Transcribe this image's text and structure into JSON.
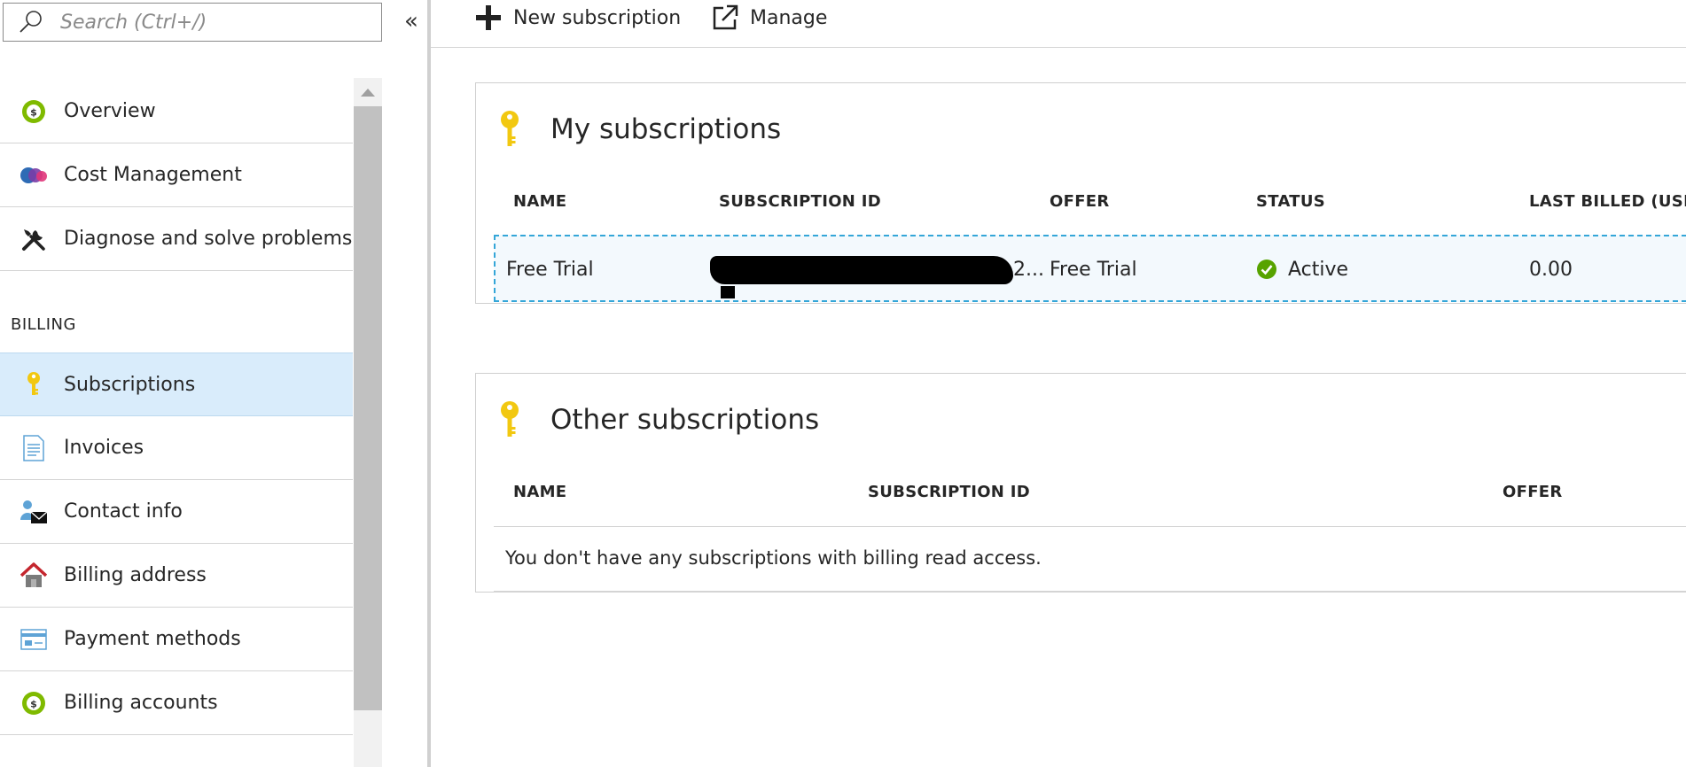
{
  "search": {
    "placeholder": "Search (Ctrl+/)"
  },
  "collapse_label": "«",
  "nav": {
    "items": [
      {
        "label": "Overview",
        "icon": "overview-coin-icon"
      },
      {
        "label": "Cost Management",
        "icon": "cost-management-icon"
      },
      {
        "label": "Diagnose and solve problems",
        "icon": "tools-icon"
      }
    ],
    "billing_section": "BILLING",
    "billing_items": [
      {
        "label": "Subscriptions",
        "icon": "key-icon",
        "selected": true
      },
      {
        "label": "Invoices",
        "icon": "document-icon"
      },
      {
        "label": "Contact info",
        "icon": "contact-icon"
      },
      {
        "label": "Billing address",
        "icon": "house-icon"
      },
      {
        "label": "Payment methods",
        "icon": "card-icon"
      },
      {
        "label": "Billing accounts",
        "icon": "billing-coin-icon"
      }
    ]
  },
  "toolbar": {
    "new_label": "New subscription",
    "manage_label": "Manage"
  },
  "my_subscriptions": {
    "title": "My subscriptions",
    "columns": [
      "NAME",
      "SUBSCRIPTION ID",
      "OFFER",
      "STATUS",
      "LAST BILLED (USD"
    ],
    "rows": [
      {
        "name": "Free Trial",
        "subscription_id_tail": "2...",
        "offer": "Free Trial",
        "status": "Active",
        "last_billed": "0.00"
      }
    ]
  },
  "other_subscriptions": {
    "title": "Other subscriptions",
    "columns": [
      "NAME",
      "SUBSCRIPTION ID",
      "OFFER"
    ],
    "empty_message": "You don't have any subscriptions with billing read access."
  },
  "colors": {
    "selected_bg": "#d9ecfb",
    "row_border": "#34a6d8",
    "status_green": "#57a300",
    "key_yellow": "#f2c811",
    "coin_green": "#7fba00"
  }
}
